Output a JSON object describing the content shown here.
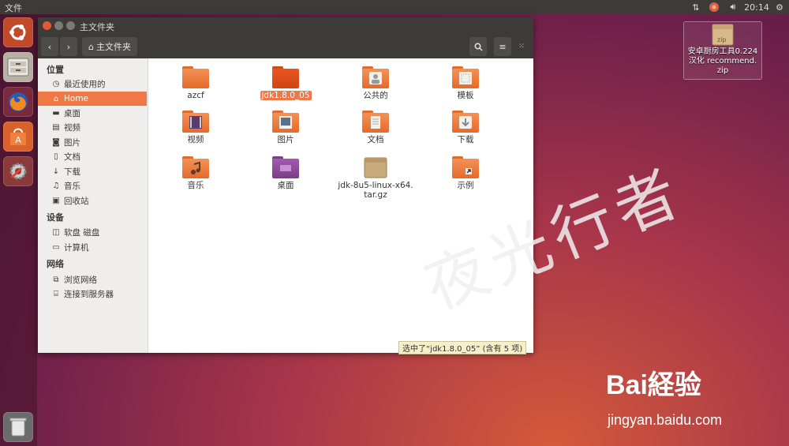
{
  "topbar": {
    "title": "文件",
    "clock": "20:14"
  },
  "launcher": {
    "items": [
      "ubuntu-dash",
      "files",
      "firefox",
      "software-center",
      "system-settings",
      "trash"
    ]
  },
  "window": {
    "title": "主文件夹",
    "path_button": "主文件夹",
    "sidebar": {
      "sections": [
        {
          "heading": "位置",
          "items": [
            {
              "label": "最近使用的",
              "icon": "clock-icon"
            },
            {
              "label": "Home",
              "icon": "home-icon",
              "selected": true
            },
            {
              "label": "桌面",
              "icon": "desktop-icon"
            },
            {
              "label": "视频",
              "icon": "video-icon"
            },
            {
              "label": "图片",
              "icon": "camera-icon"
            },
            {
              "label": "文档",
              "icon": "document-icon"
            },
            {
              "label": "下载",
              "icon": "download-icon"
            },
            {
              "label": "音乐",
              "icon": "music-icon"
            },
            {
              "label": "回收站",
              "icon": "trash-icon"
            }
          ]
        },
        {
          "heading": "设备",
          "items": [
            {
              "label": "软盘 磁盘",
              "icon": "floppy-icon"
            },
            {
              "label": "计算机",
              "icon": "computer-icon"
            }
          ]
        },
        {
          "heading": "网络",
          "items": [
            {
              "label": "浏览网络",
              "icon": "network-icon"
            },
            {
              "label": "连接到服务器",
              "icon": "server-icon"
            }
          ]
        }
      ]
    },
    "files": [
      {
        "name": "azcf",
        "type": "folder"
      },
      {
        "name": "jdk1.8.0_05",
        "type": "folder",
        "selected": true
      },
      {
        "name": "公共的",
        "type": "folder-public"
      },
      {
        "name": "模板",
        "type": "folder-templates"
      },
      {
        "name": "视频",
        "type": "folder-video"
      },
      {
        "name": "图片",
        "type": "folder-pictures"
      },
      {
        "name": "文档",
        "type": "folder-documents"
      },
      {
        "name": "下载",
        "type": "folder-downloads"
      },
      {
        "name": "音乐",
        "type": "folder-music"
      },
      {
        "name": "桌面",
        "type": "folder-desktop"
      },
      {
        "name": "jdk-8u5-linux-x64.\ntar.gz",
        "type": "archive",
        "badge": "tar.gz"
      },
      {
        "name": "示例",
        "type": "folder-examples"
      }
    ],
    "status": "选中了“jdk1.8.0_05” (含有 5 项)"
  },
  "desktop": {
    "zip_icon": {
      "badge": "zip",
      "label": "安卓厨房工具0.224\n汉化 recommend.\nzip"
    }
  },
  "watermark": {
    "text": "夜光行者",
    "brand": "Bai経验",
    "url": "jingyan.baidu.com"
  },
  "colors": {
    "accent": "#f07746",
    "panel": "#3c3b37",
    "folder": "#e9753a"
  }
}
